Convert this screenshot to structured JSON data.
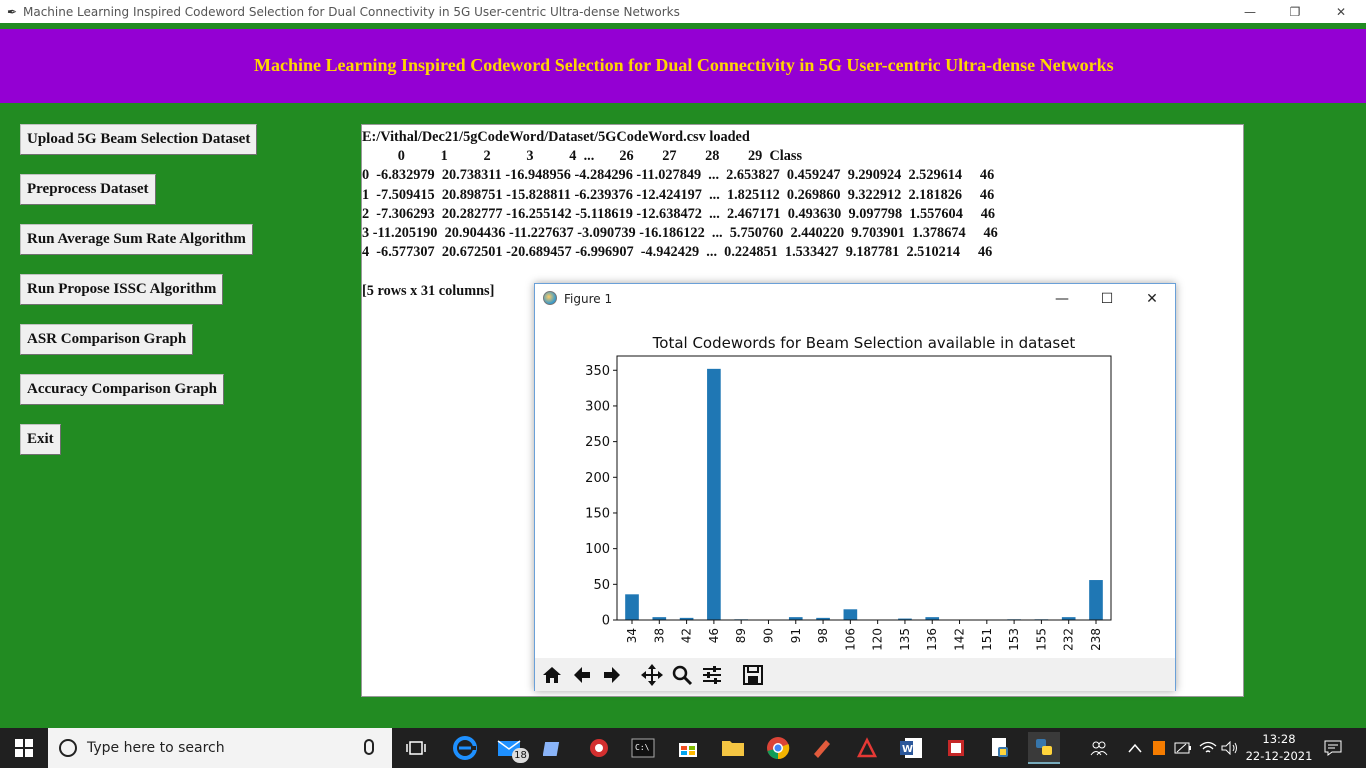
{
  "window": {
    "title": "Machine Learning Inspired Codeword Selection for Dual Connectivity in 5G User-centric Ultra-dense Networks",
    "minimize": "—",
    "restore": "❐",
    "close": "✕"
  },
  "header": {
    "title": "Machine Learning Inspired Codeword Selection for Dual Connectivity in 5G User-centric Ultra-dense Networks"
  },
  "buttons": [
    {
      "label": "Upload 5G Beam Selection Dataset"
    },
    {
      "label": "Preprocess Dataset"
    },
    {
      "label": "Run Average Sum Rate Algorithm"
    },
    {
      "label": "Run Propose ISSC Algorithm"
    },
    {
      "label": "ASR Comparison Graph"
    },
    {
      "label": "Accuracy Comparison Graph"
    },
    {
      "label": "Exit"
    }
  ],
  "output": {
    "text": "E:/Vithal/Dec21/5gCodeWord/Dataset/5GCodeWord.csv loaded\n          0          1          2          3          4  ...       26        27        28        29  Class\n0  -6.832979  20.738311 -16.948956 -4.284296 -11.027849  ...  2.653827  0.459247  9.290924  2.529614     46\n1  -7.509415  20.898751 -15.828811 -6.239376 -12.424197  ...  1.825112  0.269860  9.322912  2.181826     46\n2  -7.306293  20.282777 -16.255142 -5.118619 -12.638472  ...  2.467171  0.493630  9.097798  1.557604     46\n3 -11.205190  20.904436 -11.227637 -3.090739 -16.186122  ...  5.750760  2.440220  9.703901  1.378674     46\n4  -6.577307  20.672501 -20.689457 -6.996907  -4.942429  ...  0.224851  1.533427  9.187781  2.510214     46\n\n[5 rows x 31 columns]"
  },
  "figure": {
    "window_title": "Figure 1",
    "minimize": "—",
    "maximize": "☐",
    "close": "✕",
    "toolbar": [
      "home-icon",
      "back-icon",
      "forward-icon",
      "pan-icon",
      "zoom-icon",
      "configure-icon",
      "save-icon"
    ]
  },
  "chart_data": {
    "type": "bar",
    "title": "Total Codewords for Beam Selection available in dataset",
    "xlabel": "",
    "ylabel": "",
    "categories": [
      "34",
      "38",
      "42",
      "46",
      "89",
      "90",
      "91",
      "98",
      "106",
      "120",
      "135",
      "136",
      "142",
      "151",
      "153",
      "155",
      "232",
      "238"
    ],
    "values": [
      36,
      4,
      3,
      352,
      1,
      0,
      4,
      3,
      15,
      0,
      2,
      4,
      0,
      0,
      1,
      1,
      4,
      56
    ],
    "yticks": [
      0,
      50,
      100,
      150,
      200,
      250,
      300,
      350
    ],
    "ylim": [
      0,
      370
    ],
    "bar_color": "#1f77b4",
    "grid": false
  },
  "taskbar": {
    "search_placeholder": "Type here to search",
    "mail_badge": "18",
    "time": "13:28",
    "date": "22-12-2021"
  },
  "colors": {
    "background": "#228b22",
    "banner": "#9400d3",
    "banner_text": "#ffd700"
  }
}
